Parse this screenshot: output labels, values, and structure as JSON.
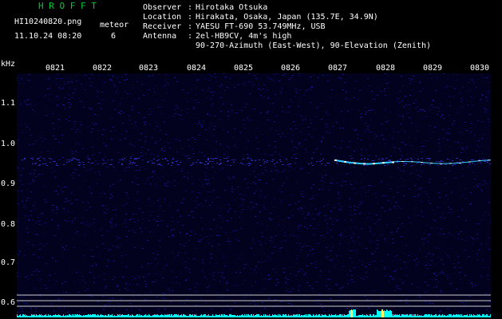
{
  "header": {
    "title": "H R O F F T",
    "filename": "HI10240820.png",
    "datetime": "11.10.24 08:20",
    "meteor_label": "meteor",
    "meteor_count": "6"
  },
  "info": [
    {
      "label": "Observer",
      "value": "Hirotaka Otsuka"
    },
    {
      "label": "Location",
      "value": "Hirakata, Osaka, Japan (135.7E, 34.9N)"
    },
    {
      "label": "Receiver",
      "value": "YAESU FT-690 53.749MHz, USB"
    },
    {
      "label": "Antenna",
      "value": "2el-HB9CV, 4m's high"
    },
    {
      "label": "",
      "value": "90-270-Azimuth (East-West), 90-Elevation (Zenith)"
    }
  ],
  "axis": {
    "unit": "kHz",
    "freq_ticks": [
      "1.1",
      "1.0",
      "0.9",
      "0.8",
      "0.7",
      "0.6"
    ],
    "time_ticks": [
      "0821",
      "0822",
      "0823",
      "0824",
      "0825",
      "0826",
      "0827",
      "0828",
      "0829",
      "0830"
    ]
  },
  "colors": {
    "background": "#000000",
    "spectrum_noise": "#0a0a6a",
    "echo": "#33ccff",
    "grid": "#ffffff",
    "title": "#00cc33",
    "baseline": "#00ffff"
  }
}
